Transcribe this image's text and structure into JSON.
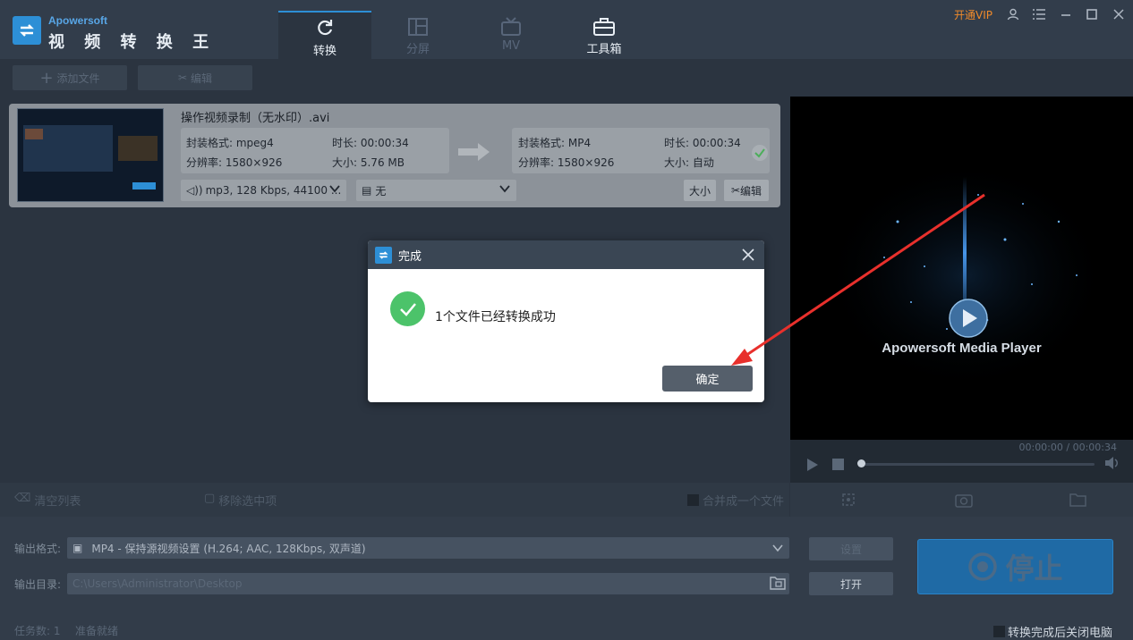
{
  "app": {
    "brand_en": "Apowersoft",
    "brand_cn": "视 频 转 换 王",
    "vip": "开通VIP"
  },
  "tabs": [
    {
      "label": "转换",
      "icon": "refresh-icon",
      "active": true
    },
    {
      "label": "分屏",
      "icon": "split-screen-icon",
      "active": false
    },
    {
      "label": "MV",
      "icon": "tv-icon",
      "active": false
    },
    {
      "label": "工具箱",
      "icon": "toolbox-icon",
      "active": false
    }
  ],
  "toolbar": {
    "add_file": "添加文件",
    "edit": "编辑"
  },
  "file": {
    "name": "操作视频录制（无水印）.avi",
    "src_format": "封装格式: mpeg4",
    "src_duration": "时长: 00:00:34",
    "src_resolution": "分辨率: 1580×926",
    "src_size": "大小: 5.76 MB",
    "dst_format": "封装格式: MP4",
    "dst_duration": "时长: 00:00:34",
    "dst_resolution": "分辨率: 1580×926",
    "dst_size": "大小: 自动",
    "audio": "mp3, 128 Kbps, 44100 ...",
    "subtitle": "无",
    "size_btn": "大小",
    "edit_btn": "编辑"
  },
  "preview": {
    "title": "Apowersoft Media Player",
    "time": "00:00:00 / 00:00:34"
  },
  "listbar": {
    "clear": "清空列表",
    "remove": "移除选中项",
    "merge": "合并成一个文件"
  },
  "output": {
    "format_label": "输出格式:",
    "format_value": "MP4 - 保持源视频设置 (H.264; AAC, 128Kbps, 双声道)",
    "dir_label": "输出目录:",
    "dir_value": "C:\\Users\\Administrator\\Desktop",
    "settings_btn": "设置",
    "open_btn": "打开",
    "stop_btn": "停止"
  },
  "status": {
    "tasks": "任务数: 1",
    "state": "准备就绪",
    "shutdown": "转换完成后关闭电脑"
  },
  "dialog": {
    "title": "完成",
    "message": "1个文件已经转换成功",
    "ok": "确定"
  }
}
